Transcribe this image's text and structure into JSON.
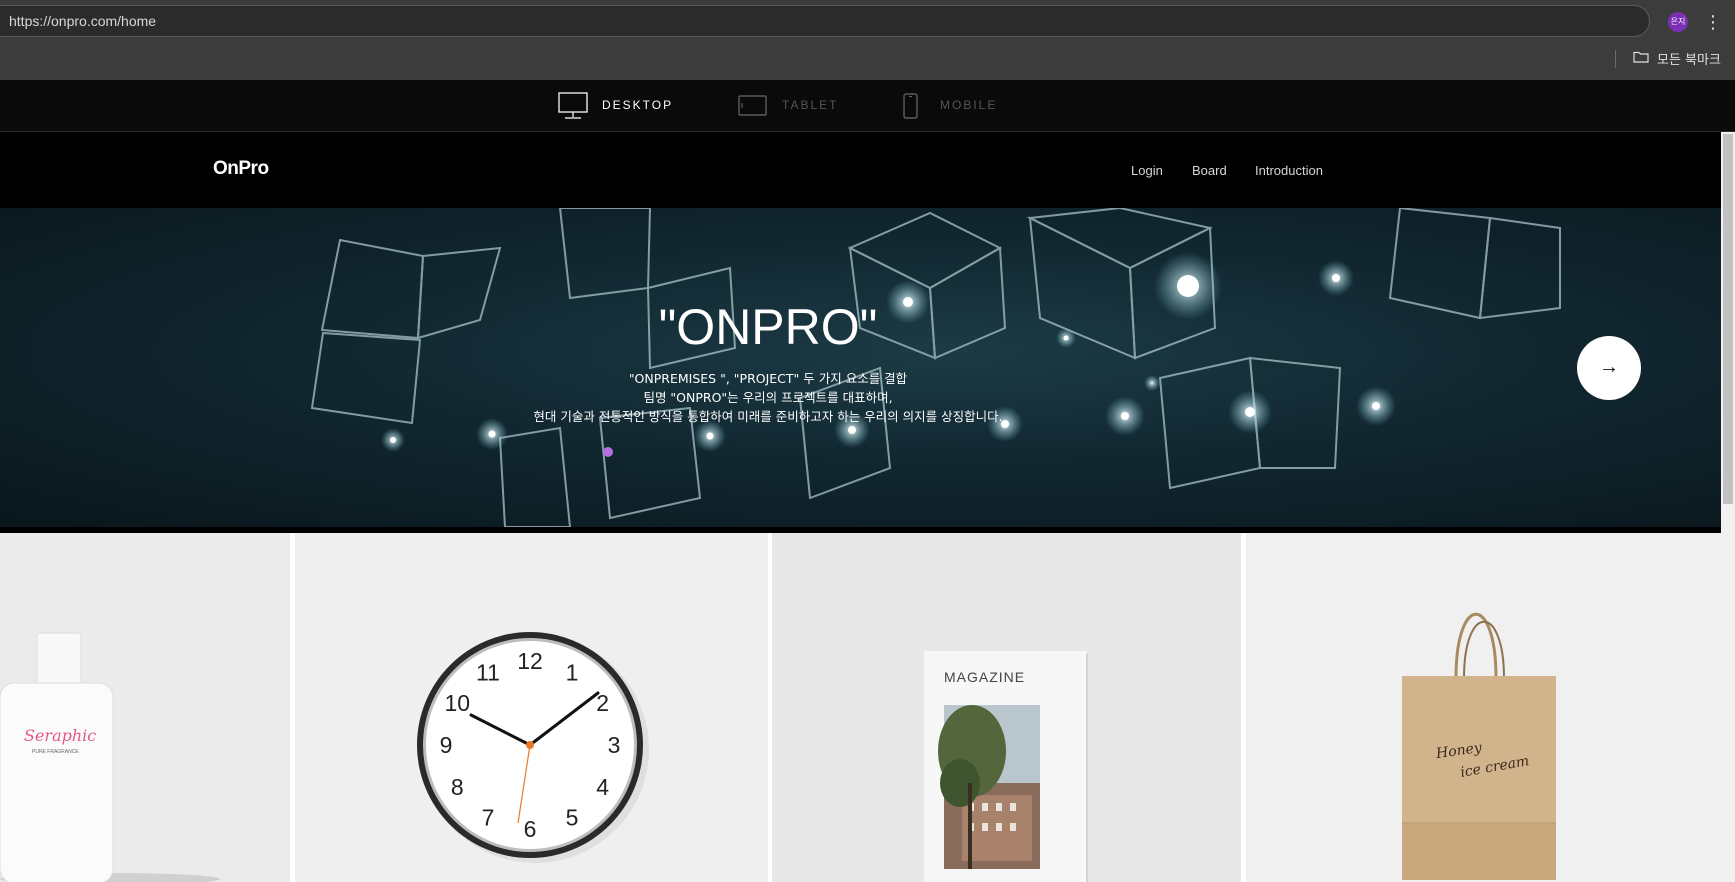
{
  "browser": {
    "url": "https://onpro.com/home",
    "profile_initials": "은지",
    "menu_icon": "kebab-icon",
    "bookmarks_label": "모든 북마크"
  },
  "device_switcher": {
    "items": [
      {
        "label": "DESKTOP",
        "icon": "desktop-icon",
        "active": true
      },
      {
        "label": "TABLET",
        "icon": "tablet-icon",
        "active": false
      },
      {
        "label": "MOBILE",
        "icon": "mobile-icon",
        "active": false
      }
    ]
  },
  "site": {
    "logo": "OnPro",
    "nav": [
      {
        "label": "Login"
      },
      {
        "label": "Board"
      },
      {
        "label": "Introduction"
      }
    ],
    "hero": {
      "title": "\"ONPRO\"",
      "lines": [
        "\"ONPREMISES \", \"PROJECT\" 두 가지 요소를 결합",
        "팀명 \"ONPRO\"는 우리의 프로젝트를 대표하며,",
        "현대 기술과 전통적인 방식을 통합하여 미래를 준비하고자 하는 우리의 의지를 상징합니다."
      ],
      "next_label": "→"
    },
    "products": [
      {
        "name": "perfume",
        "brand": "Seraphic",
        "sub": "PURE FRAGRANCE"
      },
      {
        "name": "wall-clock",
        "numbers": [
          "12",
          "1",
          "2",
          "3",
          "4",
          "5",
          "6",
          "7",
          "8",
          "9",
          "10",
          "11"
        ]
      },
      {
        "name": "magazine",
        "title": "MAGAZINE"
      },
      {
        "name": "paper-bag",
        "line1": "Honey",
        "line2": "ice cream"
      }
    ]
  },
  "colors": {
    "chrome_bg": "#3c3c3c",
    "device_bar_bg": "#0a0a0a",
    "site_bg": "#000000",
    "profile": "#7b2fb5",
    "perfume_accent": "#e4578a"
  }
}
